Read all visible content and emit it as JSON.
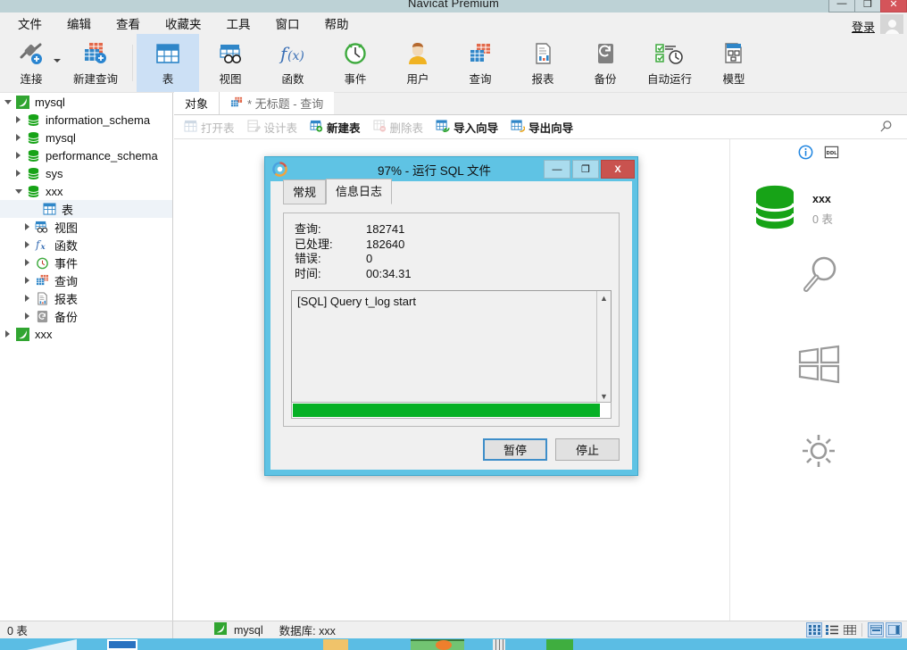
{
  "window": {
    "title": "Navicat Premium",
    "controls": {
      "minimize": "—",
      "maximize": "❐",
      "close": "✕"
    }
  },
  "menubar": {
    "items": [
      {
        "label": "文件"
      },
      {
        "label": "编辑"
      },
      {
        "label": "查看"
      },
      {
        "label": "收藏夹"
      },
      {
        "label": "工具"
      },
      {
        "label": "窗口"
      },
      {
        "label": "帮助"
      }
    ],
    "login_label": "登录"
  },
  "toolbar": {
    "items": [
      {
        "label": "连接",
        "icon": "connection-icon",
        "selected": false
      },
      {
        "label": "新建查询",
        "icon": "new-query-icon",
        "selected": false
      },
      {
        "label": "表",
        "icon": "table-icon",
        "selected": true
      },
      {
        "label": "视图",
        "icon": "view-icon",
        "selected": false
      },
      {
        "label": "函数",
        "icon": "function-icon",
        "selected": false
      },
      {
        "label": "事件",
        "icon": "event-icon",
        "selected": false
      },
      {
        "label": "用户",
        "icon": "user-icon",
        "selected": false
      },
      {
        "label": "查询",
        "icon": "query-icon",
        "selected": false
      },
      {
        "label": "报表",
        "icon": "report-icon",
        "selected": false
      },
      {
        "label": "备份",
        "icon": "backup-icon",
        "selected": false
      },
      {
        "label": "自动运行",
        "icon": "automation-icon",
        "selected": false
      },
      {
        "label": "模型",
        "icon": "model-icon",
        "selected": false
      }
    ]
  },
  "sidebar": {
    "tree": [
      {
        "label": "mysql",
        "icon": "connection-leaf-icon",
        "indent": 0,
        "twisty": "down",
        "selected": false
      },
      {
        "label": "information_schema",
        "icon": "database-icon",
        "indent": 1,
        "twisty": "right",
        "selected": false
      },
      {
        "label": "mysql",
        "icon": "database-icon",
        "indent": 1,
        "twisty": "right",
        "selected": false
      },
      {
        "label": "performance_schema",
        "icon": "database-icon",
        "indent": 1,
        "twisty": "right",
        "selected": false
      },
      {
        "label": "sys",
        "icon": "database-icon",
        "indent": 1,
        "twisty": "right",
        "selected": false
      },
      {
        "label": "xxx",
        "icon": "database-icon",
        "indent": 1,
        "twisty": "down",
        "selected": false
      },
      {
        "label": "表",
        "icon": "table-icon",
        "indent": 2,
        "twisty": "none",
        "selected": true
      },
      {
        "label": "视图",
        "icon": "view-icon",
        "indent": 2,
        "twisty": "right",
        "selected": false
      },
      {
        "label": "函数",
        "icon": "function-icon",
        "indent": 2,
        "twisty": "right",
        "selected": false
      },
      {
        "label": "事件",
        "icon": "event-icon",
        "indent": 2,
        "twisty": "right",
        "selected": false
      },
      {
        "label": "查询",
        "icon": "query-icon",
        "indent": 2,
        "twisty": "right",
        "selected": false
      },
      {
        "label": "报表",
        "icon": "report-icon",
        "indent": 2,
        "twisty": "right",
        "selected": false
      },
      {
        "label": "备份",
        "icon": "backup-icon",
        "indent": 2,
        "twisty": "right",
        "selected": false
      },
      {
        "label": "xxx",
        "icon": "connection-leaf-icon",
        "indent": 0,
        "twisty": "right",
        "selected": false
      }
    ]
  },
  "main": {
    "tabs": [
      {
        "label": "对象",
        "icon": "none",
        "active": true
      },
      {
        "label": "* 无标题 - 查询",
        "icon": "query-icon",
        "active": false
      }
    ],
    "objectbar": [
      {
        "label": "打开表",
        "icon": "open-table-icon",
        "enabled": false
      },
      {
        "label": "设计表",
        "icon": "design-table-icon",
        "enabled": false
      },
      {
        "label": "新建表",
        "icon": "new-table-icon",
        "enabled": true
      },
      {
        "label": "删除表",
        "icon": "delete-table-icon",
        "enabled": false
      },
      {
        "label": "导入向导",
        "icon": "import-icon",
        "enabled": true
      },
      {
        "label": "导出向导",
        "icon": "export-icon",
        "enabled": true
      }
    ],
    "search_icon": "search-icon",
    "info_pane": {
      "info_icon": "info-icon",
      "ddl_label": "DDL",
      "db_name": "xxx",
      "db_sub": "0 表",
      "charms": [
        "search-charm-icon",
        "start-charm-icon",
        "settings-charm-icon"
      ]
    }
  },
  "statusbar": {
    "left_text": "0 表",
    "connection": "mysql",
    "database": "数据库: xxx",
    "view_modes": [
      {
        "name": "grid-view",
        "selected": true
      },
      {
        "name": "list-view",
        "selected": false
      },
      {
        "name": "detail-view",
        "selected": false
      }
    ],
    "extra_modes": [
      {
        "name": "form-view",
        "selected": false
      },
      {
        "name": "split-view",
        "selected": false
      }
    ]
  },
  "dialog": {
    "title": "97% - 运行 SQL 文件",
    "icon": "navicat-icon",
    "controls": {
      "minimize": "—",
      "maximize": "❐",
      "close": "X"
    },
    "tabs": [
      {
        "label": "常规",
        "active": false
      },
      {
        "label": "信息日志",
        "active": true
      }
    ],
    "stats": [
      {
        "key": "查询:",
        "value": "182741"
      },
      {
        "key": "已处理:",
        "value": "182640"
      },
      {
        "key": "错误:",
        "value": "0"
      },
      {
        "key": "时间:",
        "value": "00:34.31"
      }
    ],
    "log": "[SQL] Query t_log start",
    "progress_percent": 97,
    "progress_color": "#06b025",
    "buttons": [
      {
        "label": "暂停",
        "default": true
      },
      {
        "label": "停止",
        "default": false
      }
    ]
  }
}
